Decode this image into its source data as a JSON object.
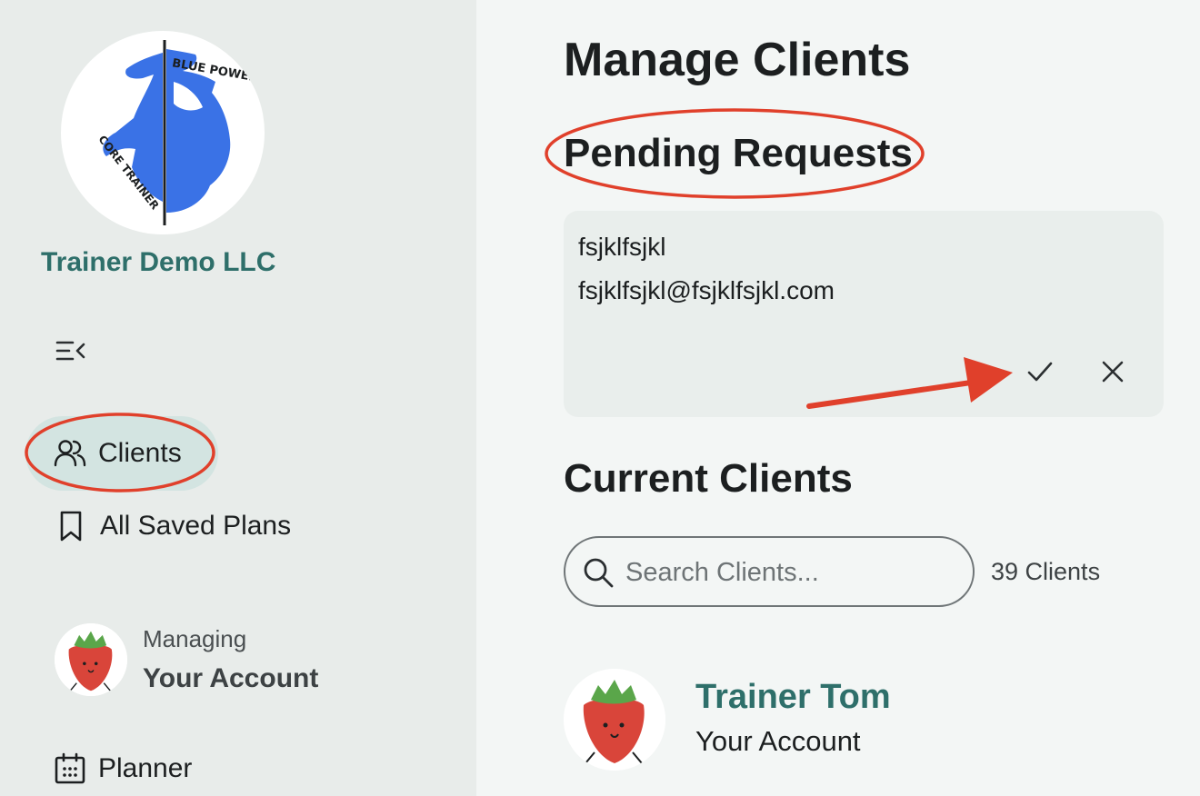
{
  "colors": {
    "accent_teal": "#2e6f6a",
    "sidebar_bg": "#e8ecea",
    "active_nav_bg": "#d3e4e1",
    "main_bg": "#f3f6f5",
    "logo_blue": "#3a72e6",
    "annotation_red": "#e0402b"
  },
  "sidebar": {
    "logo": {
      "icon": "blue-power-core-trainer-logo",
      "text_top": "BLUE POWER",
      "text_bottom": "CORE TRAINER"
    },
    "org_name": "Trainer Demo LLC",
    "collapse_icon": "collapse-sidebar-icon",
    "nav": {
      "clients": {
        "label": "Clients",
        "icon": "users-icon"
      },
      "saved_plans": {
        "label": "All Saved Plans",
        "icon": "bookmark-icon"
      },
      "planner": {
        "label": "Planner",
        "icon": "calendar-icon"
      }
    },
    "managing": {
      "label": "Managing",
      "account": "Your Account",
      "avatar": "strawberry-avatar"
    }
  },
  "main": {
    "title": "Manage Clients",
    "pending": {
      "heading": "Pending Requests",
      "requests": [
        {
          "name": "fsjklfsjkl",
          "email": "fsjklfsjkl@fsjklfsjkl.com"
        }
      ],
      "accept_icon": "check-icon",
      "reject_icon": "close-icon"
    },
    "current": {
      "heading": "Current Clients",
      "search": {
        "placeholder": "Search Clients...",
        "value": "",
        "icon": "search-icon"
      },
      "count": "39 Clients",
      "clients": [
        {
          "name": "Trainer Tom",
          "subtitle": "Your Account",
          "avatar": "strawberry-avatar"
        }
      ]
    }
  }
}
